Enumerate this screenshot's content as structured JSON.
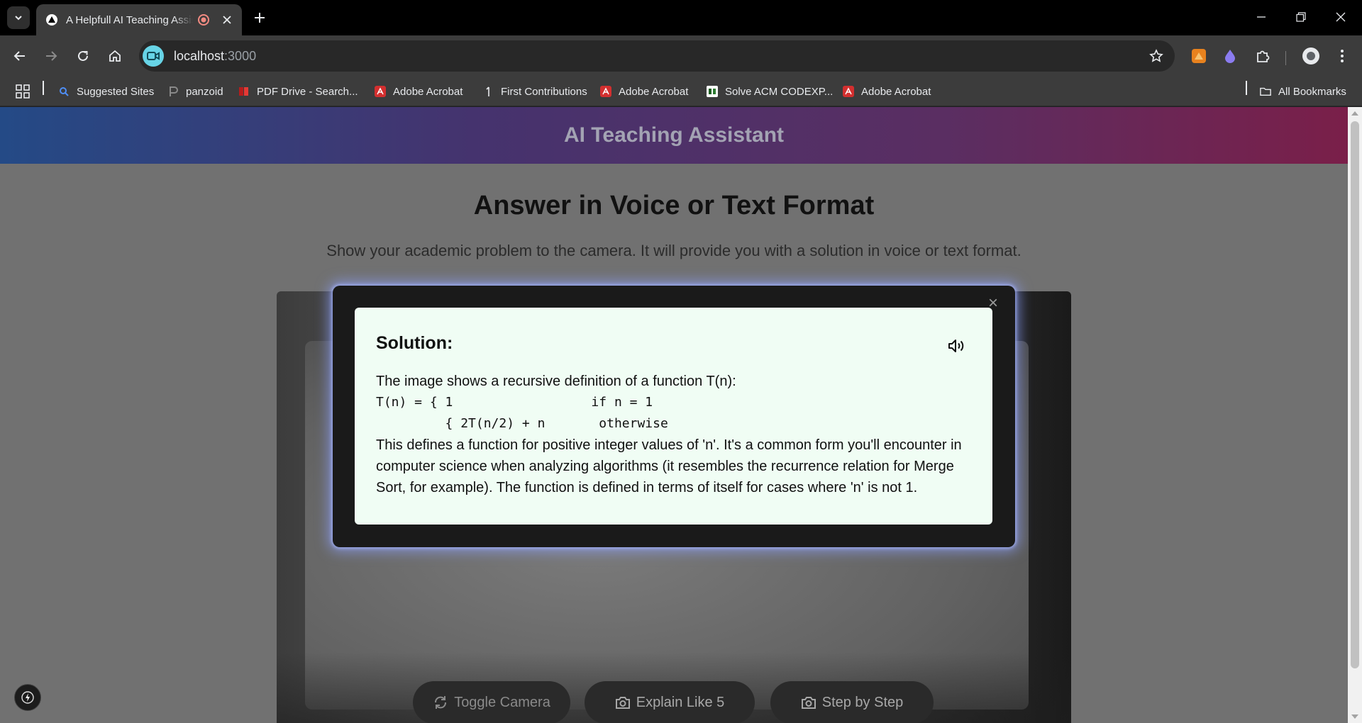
{
  "browser": {
    "tab": {
      "title": "A Helpfull AI Teaching Assistant"
    },
    "address": {
      "host": "localhost",
      "port": ":3000"
    },
    "bookmarks": [
      {
        "label": "Suggested Sites"
      },
      {
        "label": "panzoid"
      },
      {
        "label": "PDF Drive - Search..."
      },
      {
        "label": "Adobe Acrobat"
      },
      {
        "label": "First Contributions"
      },
      {
        "label": "Adobe Acrobat"
      },
      {
        "label": "Solve ACM CODEXP..."
      },
      {
        "label": "Adobe Acrobat"
      }
    ],
    "all_bookmarks": "All Bookmarks"
  },
  "app": {
    "header_title": "AI Teaching Assistant",
    "title": "Answer in Voice or Text Format",
    "subtitle": "Show your academic problem to the camera. It will provide you with a solution in voice or text format."
  },
  "controls": {
    "toggle_camera": "Toggle Camera",
    "explain_like_5": "Explain Like 5",
    "step_by_step": "Step by Step"
  },
  "modal": {
    "close_symbol": "×",
    "heading": "Solution:",
    "intro": "The image shows a recursive definition of a function T(n):",
    "code_line_1": "T(n) = { 1                  if n = 1",
    "code_line_2": "         { 2T(n/2) + n       otherwise",
    "explanation": "This defines a function for positive integer values of 'n'. It's a common form you'll encounter in computer science when analyzing algorithms (it resembles the recurrence relation for Merge Sort, for example). The function is defined in terms of itself for cases where 'n' is not 1."
  },
  "colors": {
    "header_gradient_start": "#244a86",
    "header_gradient_end": "#7a1f49",
    "modal_card_bg": "#f0fdf4",
    "modal_glow": "#8ca0ff"
  }
}
